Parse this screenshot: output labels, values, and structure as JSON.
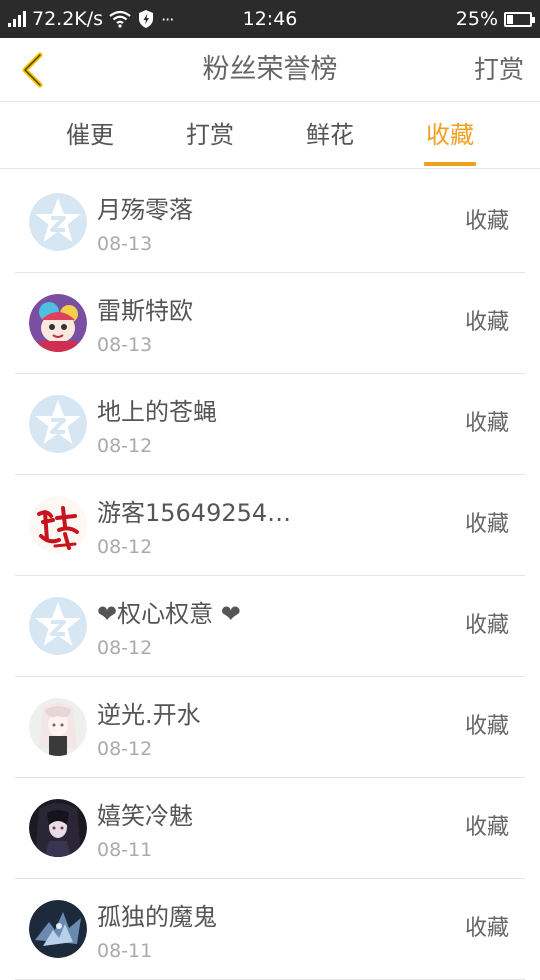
{
  "status_bar": {
    "speed": "72.2K/s",
    "dots": "···",
    "time": "12:46",
    "battery": "25%",
    "battery_level": 0.25
  },
  "header": {
    "title": "粉丝荣誉榜",
    "right_action": "打赏"
  },
  "tabs": [
    {
      "label": "催更",
      "active": false
    },
    {
      "label": "打赏",
      "active": false
    },
    {
      "label": "鲜花",
      "active": false
    },
    {
      "label": "收藏",
      "active": true
    }
  ],
  "colors": {
    "accent": "#f0a021",
    "status_bar_bg": "#2b2b2b",
    "placeholder_avatar": "#d6e6f2"
  },
  "fans": [
    {
      "name": "月殇零落",
      "date": "08-13",
      "action": "收藏",
      "avatar": "default-avatar"
    },
    {
      "name": "雷斯特欧",
      "date": "08-13",
      "action": "收藏",
      "avatar": "anime-character-avatar"
    },
    {
      "name": "地上的苍蝇",
      "date": "08-12",
      "action": "收藏",
      "avatar": "default-avatar"
    },
    {
      "name": "游客15649254…",
      "date": "08-12",
      "action": "收藏",
      "avatar": "calligraphy-avatar"
    },
    {
      "name": "❤权心权意 ❤",
      "date": "08-12",
      "action": "收藏",
      "avatar": "default-avatar"
    },
    {
      "name": "逆光.开水",
      "date": "08-12",
      "action": "收藏",
      "avatar": "anime-girl-avatar"
    },
    {
      "name": "嬉笑冷魅",
      "date": "08-11",
      "action": "收藏",
      "avatar": "dark-anime-avatar"
    },
    {
      "name": "孤独的魔鬼",
      "date": "08-11",
      "action": "收藏",
      "avatar": "dark-creature-avatar"
    }
  ]
}
